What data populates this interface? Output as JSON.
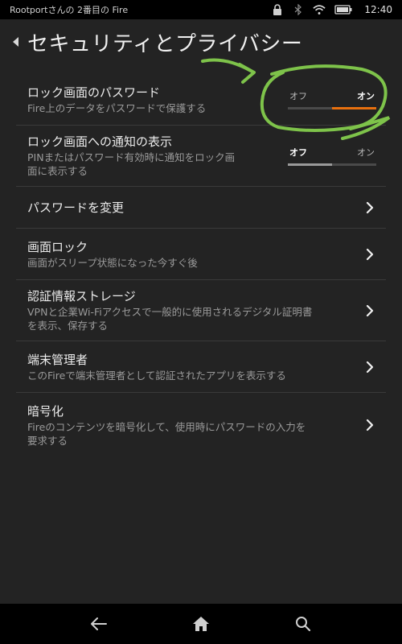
{
  "status_bar": {
    "device_name": "Rootportさんの 2番目の Fire",
    "time": "12:40",
    "icons": [
      "lock-icon",
      "bluetooth-icon",
      "wifi-icon",
      "battery-icon"
    ]
  },
  "header": {
    "title": "セキュリティとプライバシー"
  },
  "settings": {
    "lock_password": {
      "title": "ロック画面のパスワード",
      "subtitle": "Fire上のデータをパスワードで保護する",
      "toggle_off": "オフ",
      "toggle_on": "オン",
      "state": "on"
    },
    "lock_notifications": {
      "title": "ロック画面への通知の表示",
      "subtitle_line1": "PINまたはパスワード有効時に通知をロック画",
      "subtitle_line2": "面に表示する",
      "toggle_off": "オフ",
      "toggle_on": "オン",
      "state": "off"
    },
    "change_password": {
      "title": "パスワードを変更"
    },
    "screen_lock": {
      "title": "画面ロック",
      "subtitle": "画面がスリープ状態になった今すぐ後"
    },
    "credential_storage": {
      "title": "認証情報ストレージ",
      "subtitle_line1": "VPNと企業Wi-Fiアクセスで一般的に使用されるデジタル証明書",
      "subtitle_line2": "を表示、保存する"
    },
    "device_admin": {
      "title": "端末管理者",
      "subtitle": "このFireで端末管理者として認証されたアプリを表示する"
    },
    "encryption": {
      "title": "暗号化",
      "subtitle_line1": "Fireのコンテンツを暗号化して、使用時にパスワードの入力を",
      "subtitle_line2": "要求する"
    }
  },
  "colors": {
    "background": "#232323",
    "accent_orange": "#e8700e",
    "toggle_off_fill": "#9a9a9a",
    "annotation_green": "#7ec34a"
  },
  "nav_bar": {
    "icons": [
      "back-arrow-icon",
      "home-icon",
      "search-icon"
    ]
  }
}
